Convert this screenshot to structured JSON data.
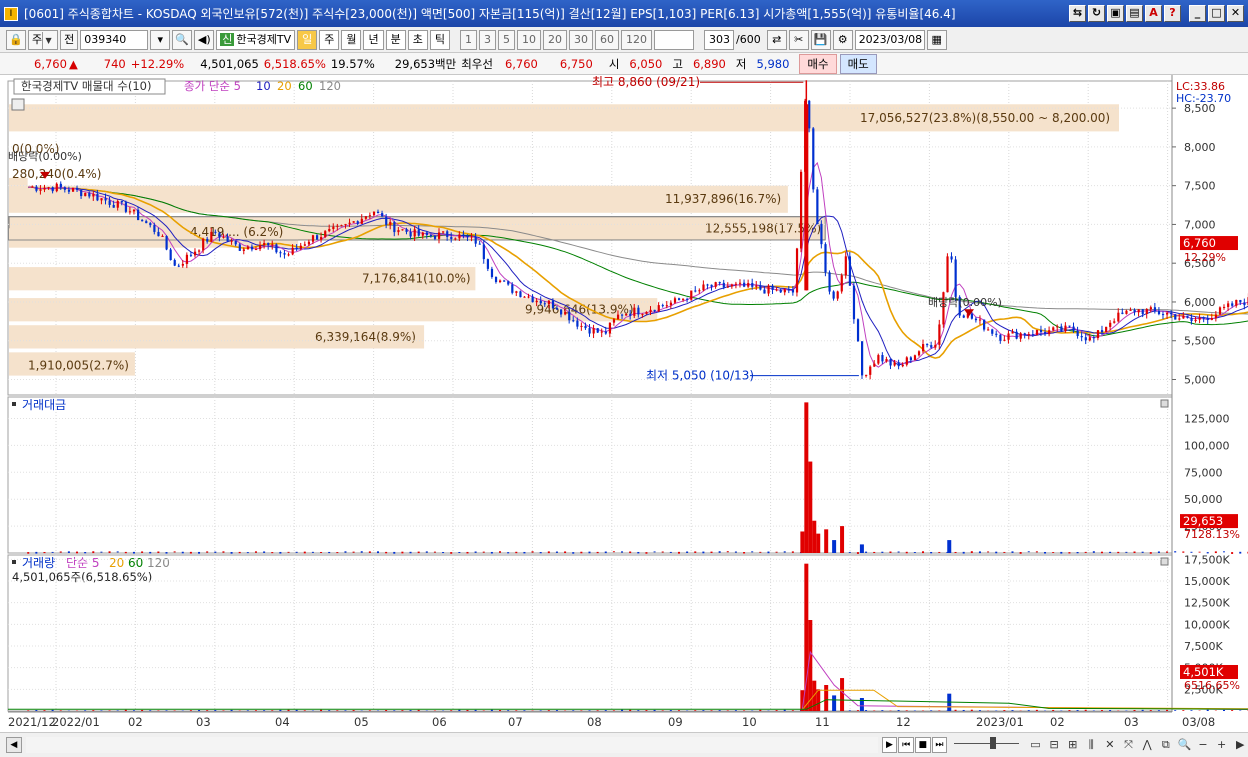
{
  "window": {
    "title": "[0601] 주식종합차트 - KOSDAQ 외국인보유[572(천)] 주식수[23,000(천)] 액면[500] 자본금[115(억)] 결산[12월] EPS[1,103] PER[6.13] 시가총액[1,555(억)] 유통비율[46.4]"
  },
  "toolbar": {
    "market": "주",
    "type": "전",
    "code": "039340",
    "brand_tag": "신",
    "name": "한국경제TV",
    "periods": [
      "일",
      "주",
      "월",
      "년",
      "분",
      "초",
      "틱"
    ],
    "active_period": "일",
    "intervals": [
      "1",
      "3",
      "5",
      "10",
      "20",
      "30",
      "60",
      "120"
    ],
    "count": "303",
    "count_max": "/600",
    "date": "2023/03/08"
  },
  "quote": {
    "price": "6,760",
    "change_arrow": "▲",
    "change": "740",
    "change_pct": "+12.29%",
    "volume": "4,501,065",
    "volume_pct": "6,518.65%",
    "turnover": "19.57%",
    "amount": "29,653백만",
    "best_label": "최우선",
    "best_ask": "6,760",
    "best_bid": "6,750",
    "open_label": "시",
    "open": "6,050",
    "high_label": "고",
    "high": "6,890",
    "low_label": "저",
    "low": "5,980",
    "buy_label": "매수",
    "sell_label": "매도"
  },
  "chart_data": {
    "type": "candlestick",
    "symbol": "한국경제TV",
    "code": "039340",
    "x_labels": [
      "2021/12",
      "2022/01",
      "02",
      "03",
      "04",
      "05",
      "06",
      "07",
      "08",
      "09",
      "10",
      "11",
      "12",
      "2023/01",
      "02",
      "03",
      "03/08"
    ],
    "price_panel": {
      "legend_title": "한국경제TV 매물대 수(10)",
      "legend_ma": [
        "종가 단순 5",
        "10",
        "20",
        "60",
        "120"
      ],
      "y_ticks": [
        5000,
        5500,
        6000,
        6500,
        7000,
        7500,
        8000,
        8500
      ],
      "ylim": [
        4800,
        8850
      ],
      "lc": "LC:33.86",
      "hc": "HC:-23.70",
      "last_price": "6,760",
      "last_pct": "12.29%",
      "high_mark": "최고 8,860 (09/21)",
      "low_mark": "최저 5,050 (10/13)",
      "ex_dividend": [
        "배당락(0.00%)",
        "배당락(0.00%)"
      ],
      "volume_profile": [
        {
          "label": "17,056,527(23.8%)(8,550.00 ~ 8,200.00)",
          "low": 8200,
          "high": 8550,
          "pct": 23.8
        },
        {
          "label": "11,937,896(16.7%)",
          "low": 7150,
          "high": 7500,
          "pct": 16.7
        },
        {
          "label": "12,555,198(17.5%)",
          "low": 6800,
          "high": 7100,
          "pct": 17.5
        },
        {
          "label": "7,176,841(10.0%)",
          "low": 6150,
          "high": 6450,
          "pct": 10.0
        },
        {
          "label": "9,946,646(13.9%)",
          "low": 5750,
          "high": 6050,
          "pct": 13.9
        },
        {
          "label": "6,339,164(8.9%)",
          "low": 5400,
          "high": 5700,
          "pct": 8.9
        },
        {
          "label": "4,419,... (6.2%)",
          "low": 6700,
          "high": 6950,
          "pct": 6.2
        },
        {
          "label": "1,910,005(2.7%)",
          "low": 5050,
          "high": 5350,
          "pct": 2.7
        },
        {
          "label": "280,240(0.4%)",
          "low": 7500,
          "high": 7600,
          "pct": 0.4
        },
        {
          "label": "0(0.0%)",
          "low": 7800,
          "high": 7900,
          "pct": 0.0
        }
      ],
      "close_path_points": [
        {
          "m": 0.0,
          "p": 7480
        },
        {
          "m": 0.4,
          "p": 7400
        },
        {
          "m": 0.9,
          "p": 7200
        },
        {
          "m": 1.3,
          "p": 6880
        },
        {
          "m": 1.5,
          "p": 6450
        },
        {
          "m": 1.7,
          "p": 6620
        },
        {
          "m": 2.0,
          "p": 6900
        },
        {
          "m": 2.3,
          "p": 6700
        },
        {
          "m": 2.6,
          "p": 6750
        },
        {
          "m": 2.9,
          "p": 6600
        },
        {
          "m": 3.2,
          "p": 6820
        },
        {
          "m": 3.6,
          "p": 6950
        },
        {
          "m": 4.0,
          "p": 7180
        },
        {
          "m": 4.2,
          "p": 6980
        },
        {
          "m": 4.6,
          "p": 6850
        },
        {
          "m": 5.0,
          "p": 6870
        },
        {
          "m": 5.3,
          "p": 6780
        },
        {
          "m": 5.5,
          "p": 6350
        },
        {
          "m": 5.7,
          "p": 6180
        },
        {
          "m": 6.0,
          "p": 6050
        },
        {
          "m": 6.3,
          "p": 5950
        },
        {
          "m": 6.6,
          "p": 5700
        },
        {
          "m": 6.9,
          "p": 5580
        },
        {
          "m": 7.1,
          "p": 5850
        },
        {
          "m": 7.4,
          "p": 5900
        },
        {
          "m": 7.8,
          "p": 6000
        },
        {
          "m": 8.2,
          "p": 6200
        },
        {
          "m": 8.6,
          "p": 6200
        },
        {
          "m": 9.0,
          "p": 6150
        },
        {
          "m": 9.3,
          "p": 6120
        },
        {
          "m": 9.45,
          "p": 8860
        },
        {
          "m": 9.55,
          "p": 7250
        },
        {
          "m": 9.7,
          "p": 6300
        },
        {
          "m": 9.8,
          "p": 6000
        },
        {
          "m": 9.95,
          "p": 6600
        },
        {
          "m": 10.15,
          "p": 5050
        },
        {
          "m": 10.35,
          "p": 5300
        },
        {
          "m": 10.6,
          "p": 5150
        },
        {
          "m": 10.9,
          "p": 5400
        },
        {
          "m": 11.1,
          "p": 5500
        },
        {
          "m": 11.25,
          "p": 6800
        },
        {
          "m": 11.35,
          "p": 5900
        },
        {
          "m": 11.6,
          "p": 5750
        },
        {
          "m": 11.9,
          "p": 5550
        },
        {
          "m": 12.2,
          "p": 5600
        },
        {
          "m": 12.5,
          "p": 5620
        },
        {
          "m": 12.8,
          "p": 5650
        },
        {
          "m": 13.05,
          "p": 5500
        },
        {
          "m": 13.3,
          "p": 5780
        },
        {
          "m": 13.6,
          "p": 5900
        },
        {
          "m": 14.0,
          "p": 5850
        },
        {
          "m": 14.3,
          "p": 5750
        },
        {
          "m": 14.6,
          "p": 5850
        },
        {
          "m": 14.9,
          "p": 6000
        },
        {
          "m": 15.05,
          "p": 6020
        },
        {
          "m": 15.12,
          "p": 6760
        }
      ]
    },
    "amount_panel": {
      "title": "거래대금",
      "y_ticks": [
        25000,
        50000,
        75000,
        100000,
        125000
      ],
      "y_tick_labels": [
        "25,000",
        "50,000",
        "75,000",
        "100,000",
        "125,000"
      ],
      "ylim": [
        0,
        145000
      ],
      "last_value": "29,653",
      "last_pct": "7128.13%",
      "spikes": [
        {
          "m": 9.4,
          "v": 20000
        },
        {
          "m": 9.45,
          "v": 140000
        },
        {
          "m": 9.5,
          "v": 85000
        },
        {
          "m": 9.55,
          "v": 30000
        },
        {
          "m": 9.6,
          "v": 18000
        },
        {
          "m": 9.7,
          "v": 22000
        },
        {
          "m": 9.8,
          "v": 12000
        },
        {
          "m": 9.9,
          "v": 25000
        },
        {
          "m": 10.15,
          "v": 8000
        },
        {
          "m": 11.25,
          "v": 12000
        },
        {
          "m": 15.12,
          "v": 29653
        }
      ]
    },
    "volume_panel": {
      "title": "거래량",
      "legend_ma": [
        "단순 5",
        "20",
        "60",
        "120"
      ],
      "volume_label": "4,501,065주(6,518.65%)",
      "y_ticks": [
        2500,
        5000,
        7500,
        10000,
        12500,
        15000,
        17500
      ],
      "y_tick_labels": [
        "2,500K",
        "5,000K",
        "7,500K",
        "10,000K",
        "12,500K",
        "15,000K",
        "17,500K"
      ],
      "ylim": [
        0,
        18000
      ],
      "last_value": "4,501K",
      "last_pct": "6516.65%",
      "spikes": [
        {
          "m": 9.4,
          "v": 2400
        },
        {
          "m": 9.45,
          "v": 17000
        },
        {
          "m": 9.5,
          "v": 10500
        },
        {
          "m": 9.55,
          "v": 3500
        },
        {
          "m": 9.6,
          "v": 2500
        },
        {
          "m": 9.7,
          "v": 3000
        },
        {
          "m": 9.8,
          "v": 1800
        },
        {
          "m": 9.9,
          "v": 3800
        },
        {
          "m": 10.15,
          "v": 1500
        },
        {
          "m": 11.25,
          "v": 2000
        },
        {
          "m": 15.12,
          "v": 4501
        }
      ]
    }
  },
  "colors": {
    "up": "#e00000",
    "down": "#0030d0",
    "ma5": "#c040c0",
    "ma10": "#2020c0",
    "ma20": "#e8a000",
    "ma60": "#008000",
    "ma120": "#8a8a8a",
    "profile": "#f5e2cc"
  }
}
